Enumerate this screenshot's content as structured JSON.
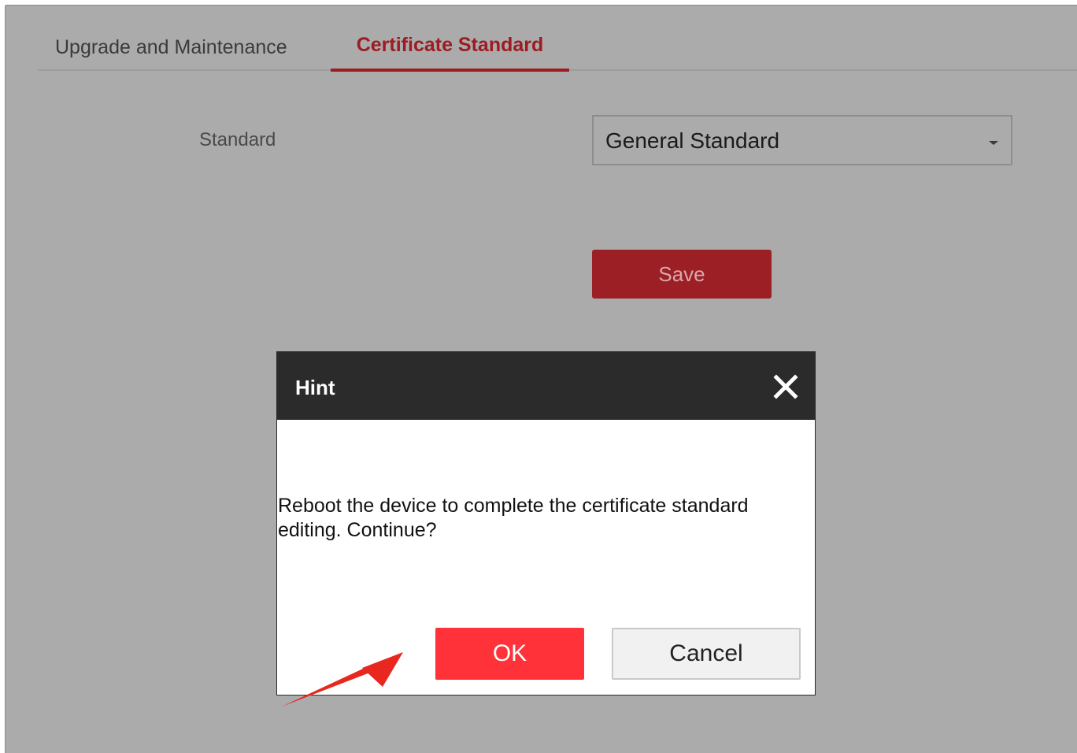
{
  "tabs": [
    {
      "label": "Upgrade and Maintenance",
      "active": false
    },
    {
      "label": "Certificate Standard",
      "active": true
    }
  ],
  "form": {
    "standard_label": "Standard",
    "standard_value": "General Standard",
    "save_label": "Save"
  },
  "dialog": {
    "title": "Hint",
    "message": "Reboot the device to complete the certificate standard editing. Continue?",
    "ok_label": "OK",
    "cancel_label": "Cancel",
    "close_icon": "close-icon"
  },
  "colors": {
    "accent": "#9e1b22",
    "ok_button": "#fe3238",
    "dialog_header": "#2b2b2b",
    "overlay_background": "#ababab",
    "annotation_arrow": "#e8281f"
  }
}
